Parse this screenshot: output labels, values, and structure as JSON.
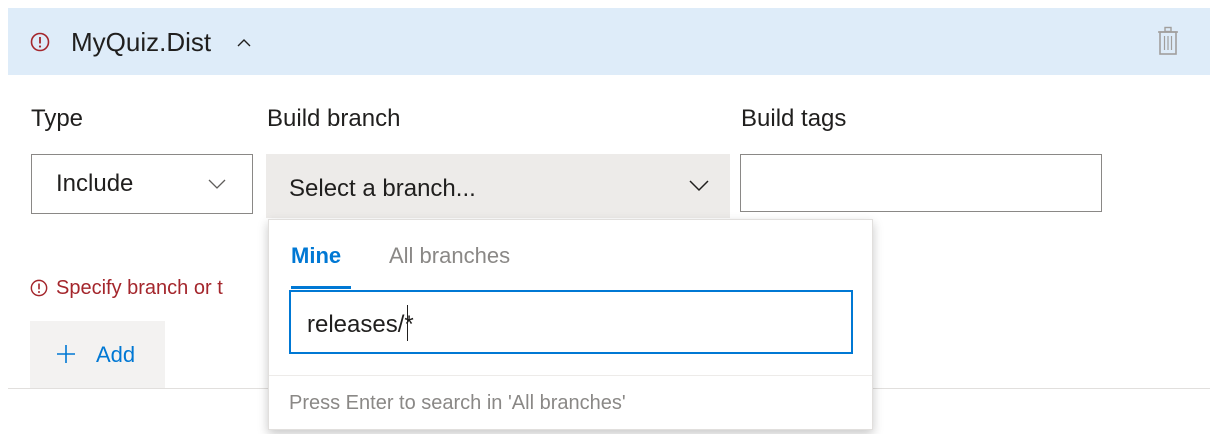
{
  "filter": {
    "title": "MyQuiz.Dist",
    "icons": {
      "error": "error-circle-icon",
      "collapse": "chevron-up-icon",
      "delete": "trash-icon"
    }
  },
  "fields": {
    "type_label": "Type",
    "type_value": "Include",
    "branch_label": "Build branch",
    "branch_placeholder": "Select a branch...",
    "tags_label": "Build tags",
    "tags_value": ""
  },
  "validation": {
    "message": "Specify branch or t"
  },
  "add_button": {
    "label": "Add"
  },
  "branch_dropdown": {
    "tabs": [
      {
        "label": "Mine",
        "active": true
      },
      {
        "label": "All branches",
        "active": false
      }
    ],
    "search_value": "releases/*",
    "hint": "Press Enter to search in 'All branches'"
  },
  "colors": {
    "accent": "#0078d4",
    "error": "#a4262c",
    "header_bg": "#deecf9"
  }
}
